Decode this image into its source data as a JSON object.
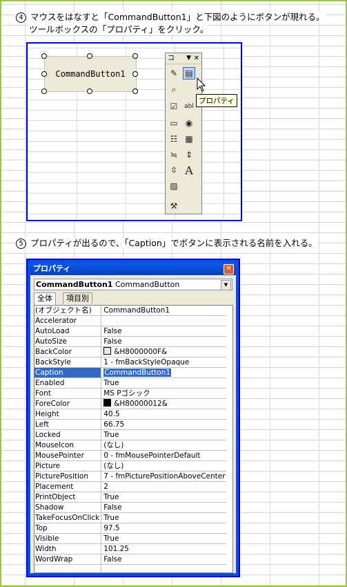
{
  "step4": {
    "number": "④",
    "line1": "マウスをはなすと「CommandButton1」と下図のようにボタンが現れる。",
    "line2": "ツールボックスの「プロパティ」をクリック。"
  },
  "shot1": {
    "button_caption": "CommandButton1",
    "toolbox_title": "コ",
    "tooltip": "プロパティ"
  },
  "step5": {
    "number": "⑤",
    "text": "プロパティが出るので、「Caption」でボタンに表示される名前を入れる。"
  },
  "properties_window": {
    "title": "プロパティ",
    "object_name": "CommandButton1",
    "object_type": "CommandButton",
    "tabs": [
      "全体",
      "項目別"
    ],
    "rows": [
      {
        "key": "(オブジェクト名)",
        "value": "CommandButton1"
      },
      {
        "key": "Accelerator",
        "value": ""
      },
      {
        "key": "AutoLoad",
        "value": "False"
      },
      {
        "key": "AutoSize",
        "value": "False"
      },
      {
        "key": "BackColor",
        "value": "&H8000000F&"
      },
      {
        "key": "BackStyle",
        "value": "1 - fmBackStyleOpaque"
      },
      {
        "key": "Caption",
        "value": "CommandButton1"
      },
      {
        "key": "Enabled",
        "value": "True"
      },
      {
        "key": "Font",
        "value": "MS Pゴシック"
      },
      {
        "key": "ForeColor",
        "value": "&H80000012&"
      },
      {
        "key": "Height",
        "value": "40.5"
      },
      {
        "key": "Left",
        "value": "66.75"
      },
      {
        "key": "Locked",
        "value": "True"
      },
      {
        "key": "MouseIcon",
        "value": "(なし)"
      },
      {
        "key": "MousePointer",
        "value": "0 - fmMousePointerDefault"
      },
      {
        "key": "Picture",
        "value": "(なし)"
      },
      {
        "key": "PicturePosition",
        "value": "7 - fmPicturePositionAboveCenter"
      },
      {
        "key": "Placement",
        "value": "2"
      },
      {
        "key": "PrintObject",
        "value": "True"
      },
      {
        "key": "Shadow",
        "value": "False"
      },
      {
        "key": "TakeFocusOnClick",
        "value": "True"
      },
      {
        "key": "Top",
        "value": "97.5"
      },
      {
        "key": "Visible",
        "value": "True"
      },
      {
        "key": "Width",
        "value": "101.25"
      },
      {
        "key": "WordWrap",
        "value": "False"
      }
    ],
    "backcolor_swatch": "#ece9d8",
    "forecolor_swatch": "#000000",
    "selection_color": "#316ac5"
  }
}
